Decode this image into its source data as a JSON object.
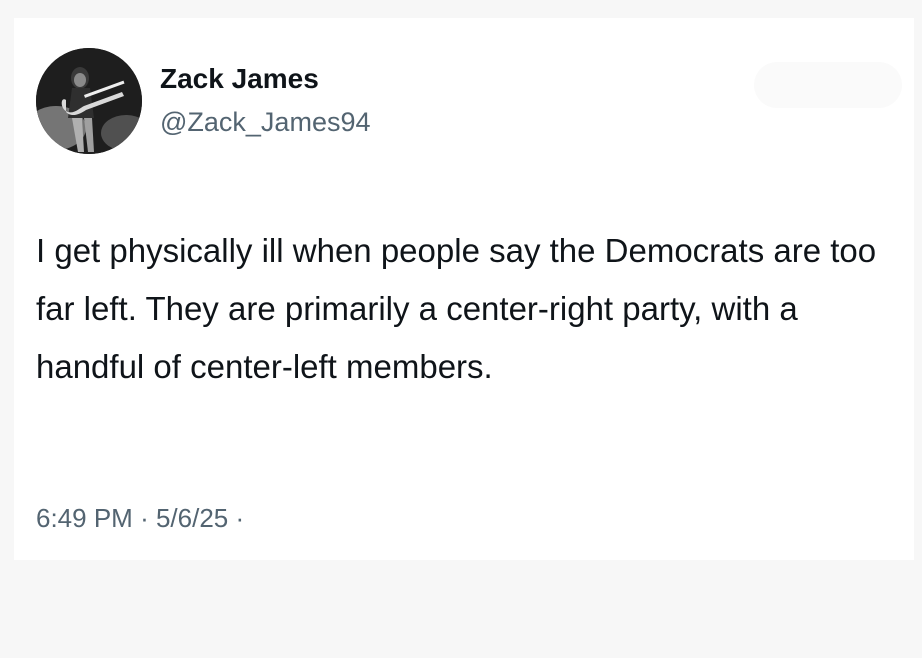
{
  "tweet": {
    "author": {
      "display_name": "Zack James",
      "handle": "@Zack_James94",
      "avatar_icon": "guitarist-photo-avatar"
    },
    "follow_button": {
      "label": ""
    },
    "text": "I get physically ill when people say the Democrats are too far left. They are primarily a center-right party, with a handful of center-left members.",
    "meta": {
      "time": "6:49 PM",
      "separator": "·",
      "date": "5/6/25",
      "views": ""
    }
  },
  "colors": {
    "text_primary": "#0f1419",
    "text_secondary": "#536471",
    "card_background": "#ffffff",
    "page_background": "#f7f7f7"
  }
}
